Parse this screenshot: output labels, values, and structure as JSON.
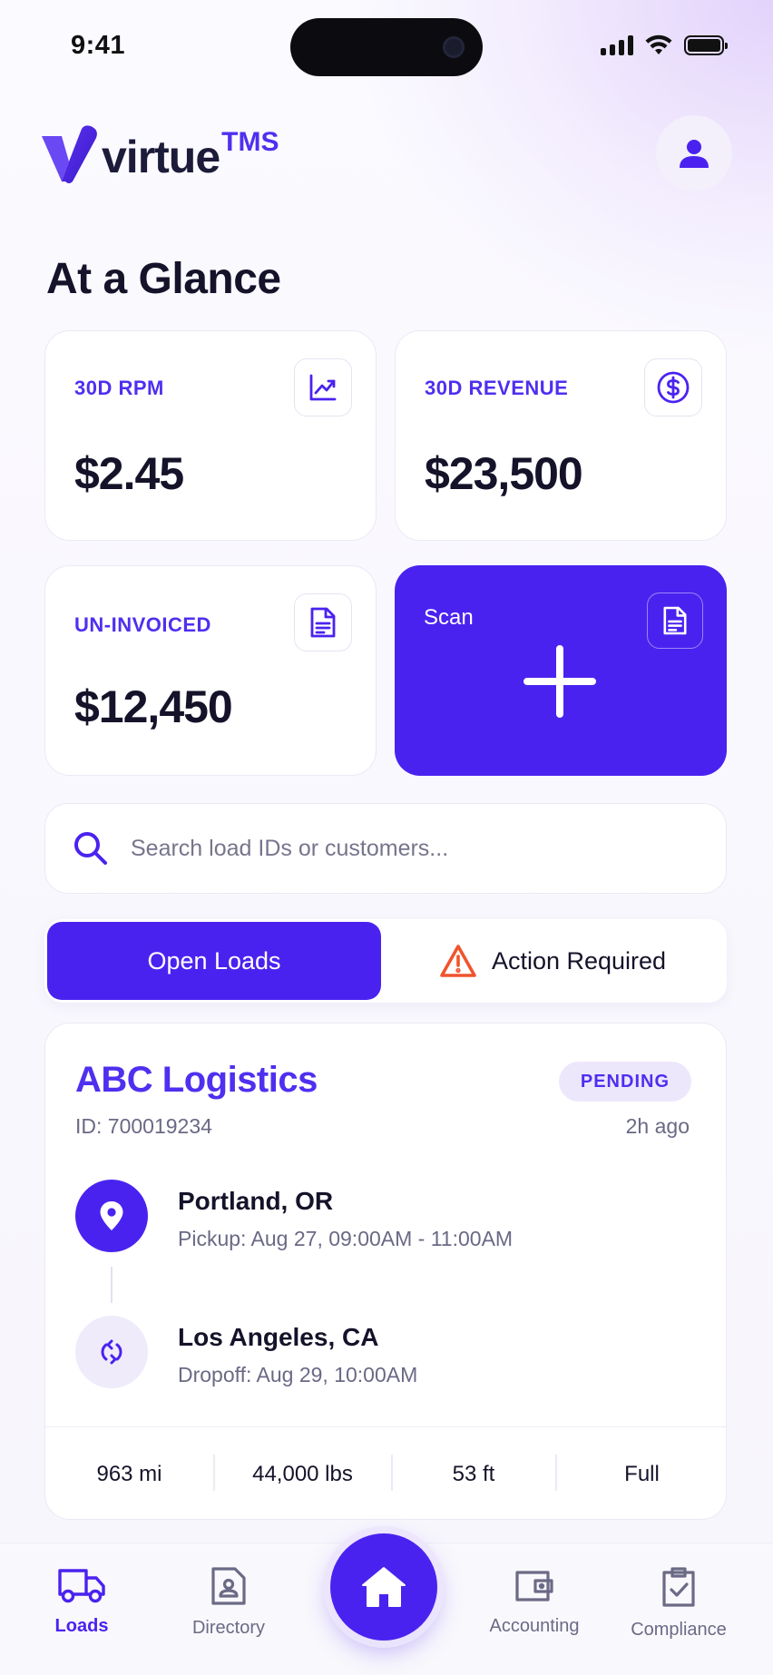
{
  "status_bar": {
    "time": "9:41"
  },
  "header": {
    "logo_text": "virtue",
    "logo_suffix": "TMS"
  },
  "page_title": "At a Glance",
  "stats": [
    {
      "label": "30D RPM",
      "value": "$2.45",
      "icon": "trending-up-icon"
    },
    {
      "label": "30D REVENUE",
      "value": "$23,500",
      "icon": "dollar-circle-icon"
    },
    {
      "label": "UN-INVOICED",
      "value": "$12,450",
      "icon": "document-icon"
    }
  ],
  "scan": {
    "label": "Scan",
    "icon": "document-icon",
    "action_icon": "plus-icon"
  },
  "search": {
    "placeholder": "Search load IDs or customers...",
    "value": ""
  },
  "tabs": {
    "open_loads": "Open Loads",
    "action_required": "Action Required",
    "active": "open_loads"
  },
  "load": {
    "company": "ABC Logistics",
    "id": "ID: 700019234",
    "status": "PENDING",
    "age": "2h ago",
    "pickup": {
      "city": "Portland, OR",
      "time": "Pickup: Aug 27, 09:00AM - 11:00AM"
    },
    "dropoff": {
      "city": "Los Angeles, CA",
      "time": "Dropoff: Aug 29, 10:00AM"
    },
    "metrics": [
      "963 mi",
      "44,000 lbs",
      "53 ft",
      "Full"
    ]
  },
  "nav": {
    "items": [
      {
        "label": "Loads",
        "icon": "truck-icon"
      },
      {
        "label": "Directory",
        "icon": "contact-card-icon"
      },
      {
        "label": "Accounting",
        "icon": "wallet-icon"
      },
      {
        "label": "Compliance",
        "icon": "clipboard-check-icon"
      }
    ],
    "home_icon": "home-icon",
    "active": "Loads"
  },
  "colors": {
    "brand": "#4a22f0",
    "accent_text": "#4f2ff0",
    "warning": "#f0542d"
  }
}
